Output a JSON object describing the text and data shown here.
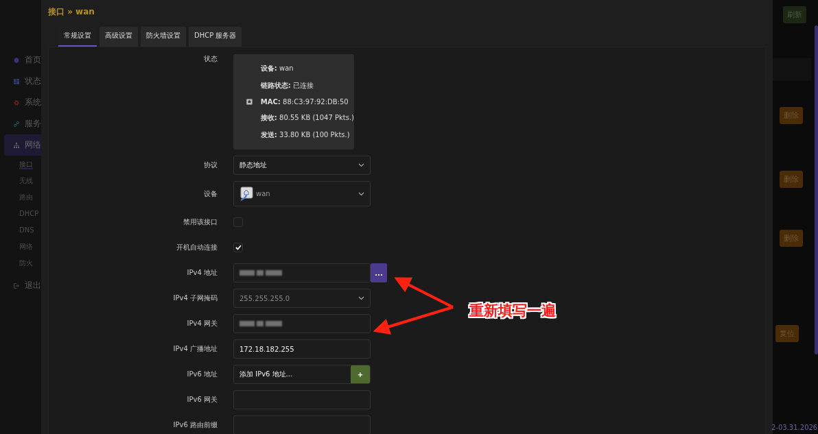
{
  "sidebar": {
    "items": [
      {
        "label": "首页",
        "selected": false
      },
      {
        "label": "状态",
        "selected": false
      },
      {
        "label": "系统",
        "selected": false
      },
      {
        "label": "服务",
        "selected": false
      },
      {
        "label": "网络",
        "selected": true,
        "children": [
          {
            "label": "接口",
            "selected": true
          },
          {
            "label": "无线",
            "selected": false
          },
          {
            "label": "路由",
            "selected": false
          },
          {
            "label": "DHCP",
            "selected": false
          },
          {
            "label": "DNS",
            "selected": false
          },
          {
            "label": "网络",
            "selected": false
          },
          {
            "label": "防火",
            "selected": false
          }
        ]
      },
      {
        "label": "退出",
        "selected": false
      }
    ]
  },
  "background_actions": [
    {
      "label": "刷新",
      "kind": "refresh"
    },
    {
      "label": "删除",
      "kind": "delete"
    },
    {
      "label": "删除",
      "kind": "delete"
    },
    {
      "label": "删除",
      "kind": "delete"
    },
    {
      "label": "复位",
      "kind": "reset"
    }
  ],
  "footer": "2-03.31.2026",
  "dialog": {
    "title": "接口 » wan",
    "tabs": [
      {
        "label": "常规设置",
        "selected": true
      },
      {
        "label": "高级设置",
        "selected": false
      },
      {
        "label": "防火墙设置",
        "selected": false
      },
      {
        "label": "DHCP 服务器",
        "selected": false
      }
    ],
    "status": {
      "label": "状态",
      "lines": [
        {
          "key": "设备:",
          "value": "wan"
        },
        {
          "key": "链路状态:",
          "value": "已连接"
        },
        {
          "key": "MAC:",
          "value": "88:C3:97:92:DB:50"
        },
        {
          "key": "接收:",
          "value": "80.55 KB (1047 Pkts.)"
        },
        {
          "key": "发送:",
          "value": "33.80 KB (100 Pkts.)"
        }
      ]
    },
    "fields": [
      {
        "label": "协议",
        "kind": "select",
        "value": "静态地址"
      },
      {
        "label": "设备",
        "kind": "device",
        "value": "wan"
      },
      {
        "label": "禁用该接口",
        "kind": "checkbox",
        "checked": false
      },
      {
        "label": "开机自动连接",
        "kind": "checkbox",
        "checked": true
      },
      {
        "label": "IPv4 地址",
        "kind": "redacted",
        "button": "..."
      },
      {
        "label": "IPv4 子网掩码",
        "kind": "select",
        "placeholder": "255.255.255.0"
      },
      {
        "label": "IPv4 网关",
        "kind": "redacted"
      },
      {
        "label": "IPv4 广播地址",
        "kind": "text",
        "value": "172.18.182.255"
      },
      {
        "label": "IPv6 地址",
        "kind": "text",
        "value": "添加 IPv6 地址...",
        "add_button": "+"
      },
      {
        "label": "IPv6 网关",
        "kind": "text"
      },
      {
        "label": "IPv6 路由前缀",
        "kind": "text"
      }
    ]
  },
  "annotation": {
    "text": "重新填写一遍"
  }
}
